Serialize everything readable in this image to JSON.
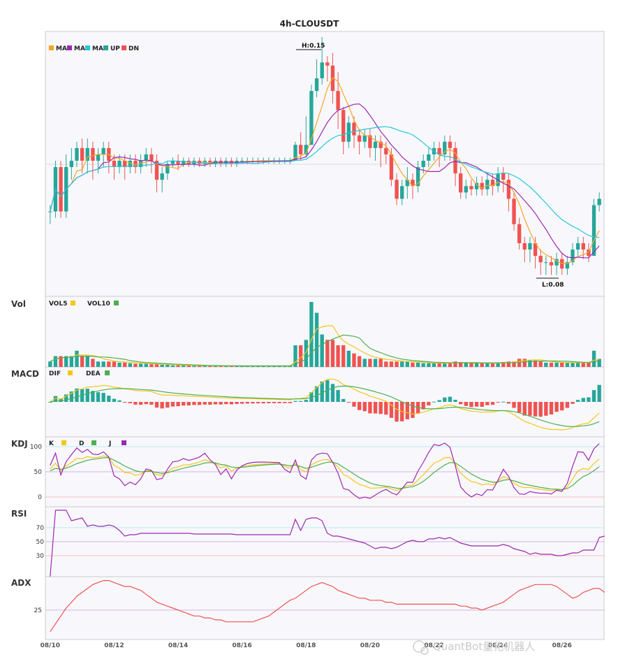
{
  "colors": {
    "up": "#26a69a",
    "down": "#ef5350",
    "ma1": "#f5a623",
    "ma2": "#9c27b0",
    "ma3": "#26c6da",
    "vol5": "#f5c518",
    "vol10": "#4caf50",
    "dif": "#f5c518",
    "dea": "#4caf50",
    "k": "#f5c518",
    "d": "#4caf50",
    "j": "#9c27b0",
    "rsi": "#9c27b0",
    "adx": "#ef5350",
    "panel_bg": "#f8f8fc",
    "ref_cyan": "#b2ebf2",
    "ref_red": "#f8bbbb",
    "ref_purple": "#d6b3e0"
  },
  "chart_data": {
    "type": "candlestick",
    "title": "4h-CLOUSDT",
    "legend": [
      {
        "label": "MA",
        "color": "#f5a623"
      },
      {
        "label": "MA",
        "color": "#9c27b0"
      },
      {
        "label": "MA",
        "color": "#26c6da"
      },
      {
        "label": "UP",
        "color": "#26a69a"
      },
      {
        "label": "DN",
        "color": "#ef5350"
      }
    ],
    "high_label": "H:0.15",
    "low_label": "L:0.08",
    "x_ticks": [
      "08/10",
      "08/12",
      "08/14",
      "08/16",
      "08/18",
      "08/20",
      "08/22",
      "08/24",
      "08/26"
    ],
    "x_tick_index": [
      0,
      12,
      24,
      36,
      48,
      60,
      72,
      84,
      96
    ],
    "price_range": [
      0.075,
      0.155
    ],
    "candles": [
      [
        0.1,
        0.1,
        0.096,
        0.102,
        1
      ],
      [
        0.1,
        0.114,
        0.098,
        0.116,
        2
      ],
      [
        0.114,
        0.1,
        0.098,
        0.116,
        2
      ],
      [
        0.1,
        0.114,
        0.098,
        0.118,
        2
      ],
      [
        0.114,
        0.116,
        0.11,
        0.12,
        2
      ],
      [
        0.116,
        0.12,
        0.114,
        0.122,
        3
      ],
      [
        0.12,
        0.116,
        0.112,
        0.123,
        2
      ],
      [
        0.116,
        0.12,
        0.112,
        0.123,
        2
      ],
      [
        0.12,
        0.116,
        0.11,
        0.122,
        1.5
      ],
      [
        0.116,
        0.118,
        0.112,
        0.12,
        1
      ],
      [
        0.118,
        0.12,
        0.114,
        0.122,
        1
      ],
      [
        0.12,
        0.116,
        0.112,
        0.122,
        1
      ],
      [
        0.116,
        0.114,
        0.11,
        0.118,
        1
      ],
      [
        0.114,
        0.116,
        0.112,
        0.118,
        0.8
      ],
      [
        0.116,
        0.114,
        0.11,
        0.118,
        0.8
      ],
      [
        0.114,
        0.116,
        0.112,
        0.118,
        0.7
      ],
      [
        0.116,
        0.114,
        0.112,
        0.118,
        0.6
      ],
      [
        0.114,
        0.116,
        0.112,
        0.118,
        0.6
      ],
      [
        0.116,
        0.118,
        0.114,
        0.12,
        0.6
      ],
      [
        0.118,
        0.116,
        0.112,
        0.12,
        0.5
      ],
      [
        0.116,
        0.11,
        0.106,
        0.118,
        0.5
      ],
      [
        0.11,
        0.112,
        0.106,
        0.114,
        0.4
      ],
      [
        0.112,
        0.115,
        0.11,
        0.116,
        0.4
      ],
      [
        0.115,
        0.116,
        0.114,
        0.117,
        0.3
      ],
      [
        0.116,
        0.115,
        0.113,
        0.118,
        0.3
      ],
      [
        0.115,
        0.116,
        0.114,
        0.117,
        0.3
      ],
      [
        0.116,
        0.115,
        0.114,
        0.117,
        0.3
      ],
      [
        0.115,
        0.116,
        0.114,
        0.117,
        0.2
      ],
      [
        0.116,
        0.115,
        0.114,
        0.117,
        0.2
      ],
      [
        0.115,
        0.116,
        0.114,
        0.117,
        0.2
      ],
      [
        0.116,
        0.115,
        0.114,
        0.117,
        0.2
      ],
      [
        0.115,
        0.116,
        0.114,
        0.117,
        0.2
      ],
      [
        0.116,
        0.115,
        0.114,
        0.117,
        0.2
      ],
      [
        0.115,
        0.116,
        0.114,
        0.117,
        0.2
      ],
      [
        0.116,
        0.115,
        0.114,
        0.117,
        0.2
      ],
      [
        0.115,
        0.116,
        0.114,
        0.117,
        0.2
      ],
      [
        0.116,
        0.116,
        0.115,
        0.117,
        0.2
      ],
      [
        0.116,
        0.116,
        0.115,
        0.117,
        0.2
      ],
      [
        0.116,
        0.116,
        0.115,
        0.117,
        0.2
      ],
      [
        0.116,
        0.116,
        0.115,
        0.117,
        0.2
      ],
      [
        0.116,
        0.116,
        0.115,
        0.117,
        0.2
      ],
      [
        0.116,
        0.116,
        0.115,
        0.117,
        0.2
      ],
      [
        0.116,
        0.116,
        0.115,
        0.117,
        0.2
      ],
      [
        0.116,
        0.116,
        0.115,
        0.117,
        0.2
      ],
      [
        0.116,
        0.116,
        0.115,
        0.117,
        0.2
      ],
      [
        0.116,
        0.116,
        0.115,
        0.117,
        0.2
      ],
      [
        0.116,
        0.121,
        0.116,
        0.122,
        4
      ],
      [
        0.121,
        0.118,
        0.116,
        0.125,
        4
      ],
      [
        0.118,
        0.121,
        0.117,
        0.13,
        5
      ],
      [
        0.121,
        0.138,
        0.121,
        0.14,
        12
      ],
      [
        0.138,
        0.142,
        0.136,
        0.148,
        10
      ],
      [
        0.142,
        0.147,
        0.14,
        0.155,
        6
      ],
      [
        0.147,
        0.146,
        0.141,
        0.149,
        5
      ],
      [
        0.146,
        0.138,
        0.134,
        0.15,
        5
      ],
      [
        0.138,
        0.132,
        0.126,
        0.144,
        4
      ],
      [
        0.132,
        0.122,
        0.118,
        0.133,
        4
      ],
      [
        0.122,
        0.128,
        0.12,
        0.13,
        3
      ],
      [
        0.128,
        0.124,
        0.12,
        0.13,
        2.5
      ],
      [
        0.124,
        0.122,
        0.118,
        0.126,
        2
      ],
      [
        0.122,
        0.124,
        0.12,
        0.126,
        1.5
      ],
      [
        0.124,
        0.12,
        0.117,
        0.126,
        1.5
      ],
      [
        0.12,
        0.122,
        0.116,
        0.124,
        1.5
      ],
      [
        0.122,
        0.12,
        0.114,
        0.124,
        1.5
      ],
      [
        0.12,
        0.118,
        0.115,
        0.122,
        1
      ],
      [
        0.118,
        0.11,
        0.108,
        0.12,
        1
      ],
      [
        0.11,
        0.104,
        0.102,
        0.112,
        1
      ],
      [
        0.104,
        0.108,
        0.102,
        0.11,
        1
      ],
      [
        0.108,
        0.11,
        0.104,
        0.114,
        1
      ],
      [
        0.11,
        0.108,
        0.104,
        0.112,
        0.8
      ],
      [
        0.108,
        0.114,
        0.106,
        0.116,
        0.8
      ],
      [
        0.114,
        0.116,
        0.112,
        0.118,
        0.7
      ],
      [
        0.116,
        0.118,
        0.114,
        0.12,
        0.7
      ],
      [
        0.118,
        0.12,
        0.116,
        0.122,
        0.7
      ],
      [
        0.12,
        0.118,
        0.114,
        0.122,
        0.7
      ],
      [
        0.118,
        0.122,
        0.116,
        0.124,
        0.7
      ],
      [
        0.122,
        0.12,
        0.116,
        0.124,
        0.7
      ],
      [
        0.12,
        0.112,
        0.108,
        0.122,
        1
      ],
      [
        0.112,
        0.106,
        0.104,
        0.114,
        0.9
      ],
      [
        0.106,
        0.108,
        0.104,
        0.11,
        0.8
      ],
      [
        0.108,
        0.107,
        0.105,
        0.11,
        0.7
      ],
      [
        0.107,
        0.109,
        0.105,
        0.111,
        0.7
      ],
      [
        0.109,
        0.107,
        0.105,
        0.111,
        0.7
      ],
      [
        0.107,
        0.11,
        0.105,
        0.112,
        0.7
      ],
      [
        0.11,
        0.108,
        0.105,
        0.112,
        0.7
      ],
      [
        0.108,
        0.112,
        0.106,
        0.114,
        0.8
      ],
      [
        0.112,
        0.11,
        0.106,
        0.114,
        0.9
      ],
      [
        0.11,
        0.104,
        0.1,
        0.112,
        1
      ],
      [
        0.104,
        0.096,
        0.094,
        0.106,
        1
      ],
      [
        0.096,
        0.09,
        0.088,
        0.098,
        1.5
      ],
      [
        0.09,
        0.088,
        0.084,
        0.092,
        1.5
      ],
      [
        0.088,
        0.09,
        0.084,
        0.092,
        1.3
      ],
      [
        0.09,
        0.086,
        0.082,
        0.092,
        1.2
      ],
      [
        0.086,
        0.084,
        0.08,
        0.088,
        1
      ],
      [
        0.084,
        0.084,
        0.08,
        0.086,
        0.8
      ],
      [
        0.084,
        0.083,
        0.08,
        0.086,
        0.8
      ],
      [
        0.083,
        0.085,
        0.08,
        0.087,
        0.8
      ],
      [
        0.085,
        0.082,
        0.08,
        0.087,
        0.8
      ],
      [
        0.082,
        0.084,
        0.08,
        0.086,
        0.8
      ],
      [
        0.084,
        0.088,
        0.083,
        0.09,
        0.8
      ],
      [
        0.088,
        0.09,
        0.086,
        0.092,
        0.8
      ],
      [
        0.09,
        0.088,
        0.085,
        0.092,
        0.8
      ],
      [
        0.088,
        0.086,
        0.084,
        0.09,
        0.8
      ],
      [
        0.086,
        0.102,
        0.086,
        0.104,
        3
      ],
      [
        0.102,
        0.104,
        0.1,
        0.106,
        1.5
      ]
    ],
    "indicators": {
      "vol_legend": [
        {
          "label": "VOL5",
          "color": "#f5c518"
        },
        {
          "label": "VOL10",
          "color": "#4caf50"
        }
      ],
      "macd_legend": [
        {
          "label": "DIF",
          "color": "#f5c518"
        },
        {
          "label": "DEA",
          "color": "#4caf50"
        }
      ],
      "kdj_legend": [
        {
          "label": "K",
          "color": "#f5c518"
        },
        {
          "label": "D",
          "color": "#4caf50"
        },
        {
          "label": "J",
          "color": "#9c27b0"
        }
      ],
      "kdj_ticks": [
        "100",
        "50",
        "0"
      ],
      "kdj_levels": [
        100,
        50,
        0
      ],
      "rsi_ticks": [
        "70",
        "50",
        "30"
      ],
      "rsi_levels": [
        70,
        50,
        30
      ],
      "adx_ticks": [
        "25"
      ],
      "adx_levels": [
        25
      ],
      "rsi": [
        0,
        95,
        95,
        95,
        80,
        82,
        84,
        72,
        74,
        72,
        72,
        74,
        72,
        66,
        58,
        60,
        60,
        62,
        62,
        62,
        62,
        62,
        62,
        62,
        62,
        62,
        62,
        61,
        61,
        61,
        61,
        61,
        61,
        61,
        61,
        60,
        60,
        60,
        60,
        60,
        60,
        60,
        60,
        60,
        60,
        60,
        82,
        66,
        82,
        84,
        84,
        80,
        62,
        58,
        58,
        56,
        54,
        52,
        50,
        48,
        44,
        40,
        42,
        42,
        40,
        42,
        46,
        50,
        52,
        50,
        50,
        54,
        54,
        56,
        54,
        56,
        52,
        48,
        46,
        44,
        44,
        44,
        44,
        44,
        44,
        46,
        44,
        40,
        38,
        36,
        32,
        34,
        32,
        32,
        32,
        30,
        30,
        32,
        34,
        34,
        38,
        38,
        38,
        56,
        58
      ],
      "adx": [
        14,
        18,
        22,
        26,
        29,
        32,
        34,
        36,
        38,
        39,
        40,
        40,
        39,
        38,
        37,
        37,
        36,
        35,
        33,
        31,
        29,
        28,
        27,
        26,
        25,
        24,
        23,
        22,
        22,
        21,
        21,
        20,
        20,
        19,
        19,
        19,
        19,
        19,
        19,
        20,
        21,
        22,
        24,
        26,
        28,
        30,
        31,
        33,
        35,
        37,
        38,
        39,
        38,
        37,
        35,
        34,
        33,
        32,
        31,
        31,
        30,
        30,
        30,
        29,
        29,
        28,
        28,
        28,
        28,
        28,
        28,
        28,
        28,
        28,
        28,
        28,
        28,
        27,
        27,
        26,
        26,
        25,
        26,
        27,
        28,
        29,
        31,
        33,
        35,
        36,
        37,
        38,
        38,
        38,
        38,
        37,
        35,
        33,
        31,
        32,
        34,
        35,
        36,
        36,
        34
      ]
    }
  },
  "watermark": "QuantBot量化机器人",
  "labels": {
    "vol": "Vol",
    "macd": "MACD",
    "kdj": "KDJ",
    "rsi": "RSI",
    "adx": "ADX"
  }
}
